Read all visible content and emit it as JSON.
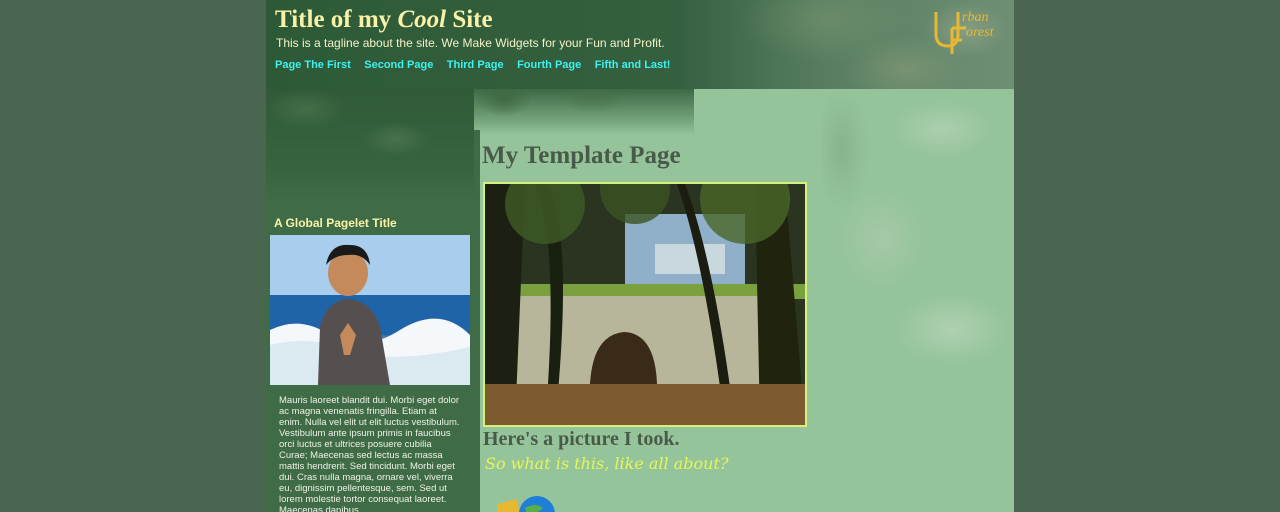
{
  "header": {
    "title_prefix": "Title of my ",
    "title_emphasis": "Cool",
    "title_suffix": " Site",
    "tagline": "This is a tagline about the site. We Make Widgets for your Fun and Profit.",
    "logo_line1": "rban",
    "logo_line2": "orest"
  },
  "nav": {
    "items": [
      "Page The First",
      "Second Page",
      "Third Page",
      "Fourth Page",
      "Fifth and Last!"
    ]
  },
  "sidebar": {
    "pagelet_title": "A Global Pagelet Title",
    "body_text": "Mauris laoreet blandit dui. Morbi eget dolor ac magna venenatis fringilla. Etiam at enim. Nulla vel elit ut elit luctus vestibulum. Vestibulum ante ipsum primis in faucibus orci luctus et ultrices posuere cubilia Curae; Maecenas sed lectus ac massa mattis hendrerit. Sed tincidunt. Morbi eget dui. Cras nulla magna, ornare vel, viverra eu, dignissim pellentesque, sem. Sed ut lorem molestie tortor consequat laoreet. Maecenas dapibus."
  },
  "main": {
    "title": "My Template Page",
    "caption": "Here's a picture I took.",
    "subcaption": "So what is this, like all about?"
  },
  "colors": {
    "page_bg": "#95c49a",
    "outer_bg": "#4a6650",
    "title_yellow": "#f8f2a8",
    "nav_cyan": "#3ef0f0",
    "photo_border": "#d6f07a",
    "subcaption": "#e4f65a"
  },
  "icons": {
    "logo": "urban-forest-logo",
    "globe": "globe-icon"
  }
}
